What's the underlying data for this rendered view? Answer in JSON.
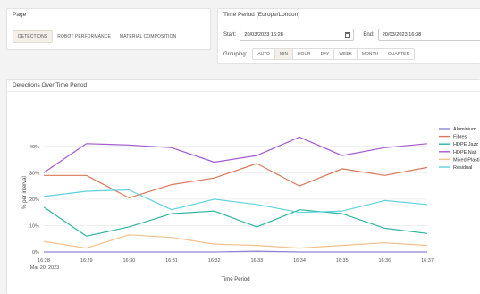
{
  "page_panel": {
    "title": "Page",
    "tabs": [
      {
        "label": "DETECTIONS",
        "active": true
      },
      {
        "label": "ROBOT PERFORMANCE",
        "active": false
      },
      {
        "label": "MATERIAL COMPOSITION",
        "active": false
      }
    ]
  },
  "time_panel": {
    "title": "Time Period (Europe/London)",
    "start_label": "Start:",
    "start_value": "20/03/2023 16:28",
    "end_label": "End:",
    "end_value": "20/03/2023 16:38",
    "grouping_label": "Grouping:",
    "grouping_options": [
      {
        "label": "AUTO",
        "active": false
      },
      {
        "label": "MIN",
        "active": true
      },
      {
        "label": "HOUR",
        "active": false
      },
      {
        "label": "DAY",
        "active": false
      },
      {
        "label": "WEEK",
        "active": false
      },
      {
        "label": "MONTH",
        "active": false
      },
      {
        "label": "QUARTER",
        "active": false
      }
    ]
  },
  "chart_panel": {
    "title": "Detections Over Time Period"
  },
  "chart_data": {
    "type": "line",
    "title": "",
    "xlabel": "Time Period",
    "ylabel": "% per interval",
    "x": [
      "16:28",
      "16:29",
      "16:30",
      "16:31",
      "16:32",
      "16:33",
      "16:34",
      "16:35",
      "16:36",
      "16:37"
    ],
    "x_sublabel": "Mar 20, 2023",
    "ylim": [
      0,
      45
    ],
    "yticks": [
      0,
      10,
      20,
      30,
      40
    ],
    "ytick_labels": [
      "0%",
      "10%",
      "20%",
      "30%",
      "40%"
    ],
    "grid": true,
    "legend_position": "right",
    "series": [
      {
        "name": "Aluminium",
        "color": "#8e84d8",
        "values": [
          0,
          0,
          0,
          0,
          0,
          0.3,
          0,
          0,
          0,
          0
        ]
      },
      {
        "name": "Fibres",
        "color": "#d9785a",
        "values": [
          29,
          29,
          20.5,
          25.5,
          28,
          33.5,
          25,
          31.5,
          29,
          32
        ]
      },
      {
        "name": "HDPE Jazz",
        "color": "#2eb5a0",
        "values": [
          17,
          6,
          9.5,
          14.5,
          15.5,
          9.5,
          16,
          14.5,
          9,
          7
        ]
      },
      {
        "name": "HDPE Nat",
        "color": "#a45ad0",
        "values": [
          30,
          41,
          40.5,
          39.5,
          34,
          36.5,
          43.5,
          36.5,
          39.5,
          41
        ]
      },
      {
        "name": "Mixed Plasti",
        "color": "#f5c089",
        "values": [
          4,
          1.5,
          6.5,
          5.5,
          3,
          2.5,
          1.5,
          2.5,
          3.5,
          2.5
        ]
      },
      {
        "name": "Residual",
        "color": "#5fd1e0",
        "values": [
          21,
          23,
          23.5,
          16,
          20,
          18,
          15,
          15.5,
          19.5,
          18
        ]
      }
    ]
  }
}
